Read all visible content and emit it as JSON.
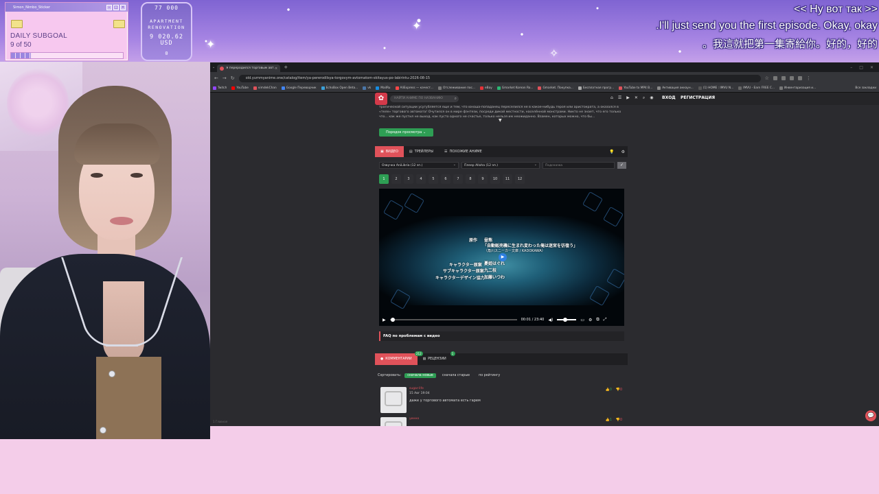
{
  "goal_widget": {
    "window_title": "Simon_Nimbo_Sticker",
    "label": "DAILY SUBGOAL",
    "count": "9 of 50",
    "progress_fraction": 0.18
  },
  "renovation_widget": {
    "top_value": "77 000",
    "label_line1": "APARTMENT",
    "label_line2": "RENOVATION",
    "amount": "9 020.62",
    "currency": "USD",
    "bottom_value": "0"
  },
  "subtitles": {
    "line1": "<< Ну вот так >>",
    "line2": ".I'll just send you the first episode. Okay, okay",
    "line3": "。我這就把第一集寄給你。好的，好的"
  },
  "browser": {
    "tab_title": "Я переродился торговым авт...",
    "url": "old.yummyanime.one/catalog/item/ya-pererodilsya-torgovym-avtomatom-skitayus-po-labirintu-2026-08-15",
    "bookmarks": [
      {
        "label": "Twitch",
        "color": "#9146ff"
      },
      {
        "label": "YouTube",
        "color": "#ff0000"
      },
      {
        "label": "vimdekChan",
        "color": "#e0525a"
      },
      {
        "label": "Google Переводчик",
        "color": "#4285f4"
      },
      {
        "label": "EchoBox Open Beta...",
        "color": "#3aa0d8"
      },
      {
        "label": "vk",
        "color": "#4a76a8"
      },
      {
        "label": "MailRu",
        "color": "#168de2"
      },
      {
        "label": "AliExpress — качест...",
        "color": "#ff4747"
      },
      {
        "label": "Отслеживание пос...",
        "color": "#777777"
      },
      {
        "label": "eBay",
        "color": "#e53238"
      },
      {
        "label": "Gmarket Korean Ro...",
        "color": "#2bb673"
      },
      {
        "label": "Gmarket. Покупка...",
        "color": "#e0525a"
      },
      {
        "label": "Бесплатная прогр...",
        "color": "#aaaaaa"
      },
      {
        "label": "YouTube to MP4 B...",
        "color": "#e0525a"
      },
      {
        "label": "Активация аккаун...",
        "color": "#888888"
      },
      {
        "label": "(1) HOME : IMVU N...",
        "color": "#555555"
      },
      {
        "label": "IMVU - Earn FREE C...",
        "color": "#666666"
      },
      {
        "label": "Инвентаризация и...",
        "color": "#777777"
      }
    ],
    "bookmarks_right": "Все закладки"
  },
  "site": {
    "logo_glyph": "✿",
    "search_placeholder": "НАЙТИ АНИМЕ ПО НАЗВАНИЮ",
    "login": "ВХОД",
    "register": "РЕГИСТРАЦИЯ",
    "description": "трагической ситуации усугубляется еще и тем, что юноша-попаданец переселился не в какое-нибудь героя или аристократа, а оказался в «теле» торгового автомата! Очутился он в мире фэнтези, посреди дикой местности, населённой монстрами. Никто не знает, что его только что... как же пустил не выход, как пусто одного не счастье, только нельзя им неожиданно. Взамен, которых можно, что бы...",
    "order_button": "Порядок просмотра",
    "video_tabs": [
      "ВИДЕО",
      "ТРЕЙЛЕРЫ",
      "ПОХОЖИЕ АНИМЕ"
    ],
    "dub_select": "Озвучка AniLibria (12 эп.)",
    "player_select": "Плеер Alloha (12 эп.)",
    "hint_placeholder": "Подсказка",
    "episodes": [
      "1",
      "2",
      "3",
      "4",
      "5",
      "6",
      "7",
      "8",
      "9",
      "10",
      "11",
      "12"
    ],
    "active_episode": "1",
    "player": {
      "credits": [
        {
          "role": "原作",
          "name": "昼熊"
        },
        {
          "role": "",
          "name": "「自動販売機に生まれ変わった俺は迷宮を彷徨う」"
        },
        {
          "role": "",
          "name": "（角川スニーカー文庫 / KADOKAWA）"
        },
        {
          "role": "キャラクター原案",
          "name": "憂姫はぐれ"
        },
        {
          "role": "サブキャラクター原案",
          "name": "九二枝"
        },
        {
          "role": "キャラクターデザイン協力",
          "name": "加藤いつわ"
        }
      ],
      "current_time": "00:01",
      "separator": "/",
      "duration": "23:40",
      "progress_fraction": 0.01,
      "volume_fraction": 0.3
    },
    "faq": "FAQ по проблемам с видео",
    "comment_tabs": [
      {
        "label": "КОММЕНТАРИИ",
        "badge": "212"
      },
      {
        "label": "РЕЦЕНЗИИ",
        "badge": "1"
      }
    ],
    "sort_label": "Сортировать:",
    "sort_options": [
      "сначала новые",
      "сначала старые",
      "по рейтингу"
    ],
    "comments": [
      {
        "user": "sugar-life",
        "date": "15 Авг 19:04",
        "text": "даже у торгового автомата есть гарем",
        "up": "0",
        "down": "0"
      },
      {
        "user": "уинно",
        "date": "",
        "text": "",
        "up": "1",
        "down": "0"
      }
    ],
    "left_hint": "1 Главная"
  }
}
